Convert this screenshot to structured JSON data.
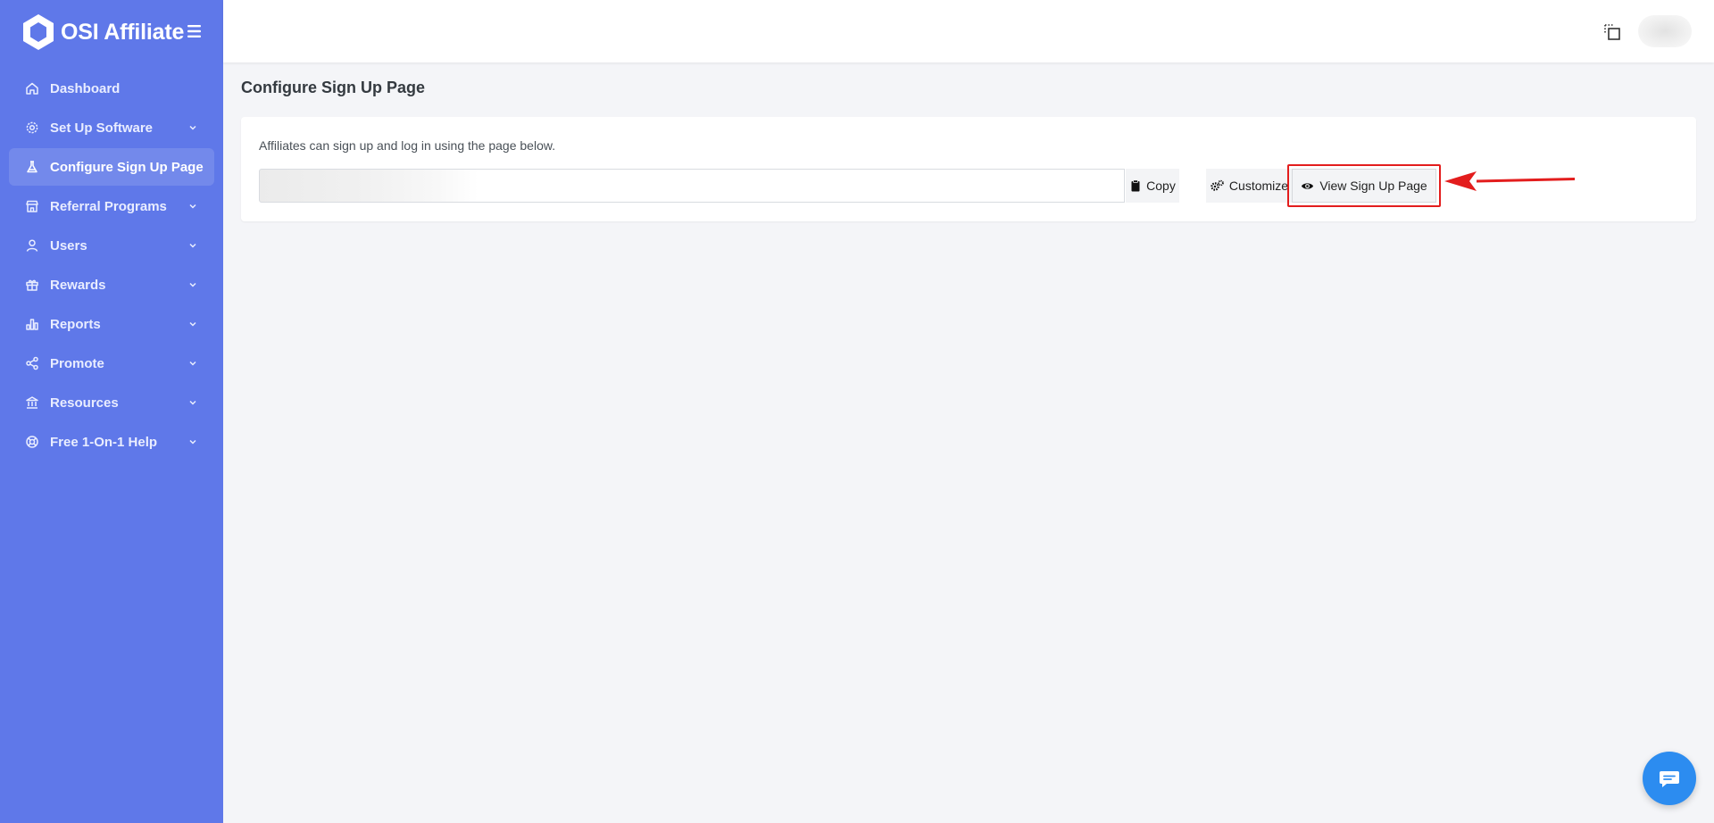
{
  "app": {
    "brand": "OSI Affiliate",
    "colors": {
      "sidebar": "#5f78e9",
      "highlight": "#e31d1d",
      "chat": "#2c8cf0"
    }
  },
  "sidebar": {
    "items": [
      {
        "label": "Dashboard",
        "icon": "home-icon",
        "has_submenu": false,
        "active": false
      },
      {
        "label": "Set Up Software",
        "icon": "gear-icon",
        "has_submenu": true,
        "active": false
      },
      {
        "label": "Configure Sign Up Page",
        "icon": "flask-icon",
        "has_submenu": false,
        "active": true
      },
      {
        "label": "Referral Programs",
        "icon": "store-icon",
        "has_submenu": true,
        "active": false
      },
      {
        "label": "Users",
        "icon": "user-icon",
        "has_submenu": true,
        "active": false
      },
      {
        "label": "Rewards",
        "icon": "gift-icon",
        "has_submenu": true,
        "active": false
      },
      {
        "label": "Reports",
        "icon": "bar-chart-icon",
        "has_submenu": true,
        "active": false
      },
      {
        "label": "Promote",
        "icon": "share-icon",
        "has_submenu": true,
        "active": false
      },
      {
        "label": "Resources",
        "icon": "bank-icon",
        "has_submenu": true,
        "active": false
      },
      {
        "label": "Free 1-On-1 Help",
        "icon": "lifebuoy-icon",
        "has_submenu": true,
        "active": false
      }
    ]
  },
  "page": {
    "title": "Configure Sign Up Page",
    "description": "Affiliates can sign up and log in using the page below.",
    "url_value": "",
    "buttons": {
      "copy": "Copy",
      "customize": "Customize",
      "view": "View Sign Up Page"
    }
  }
}
